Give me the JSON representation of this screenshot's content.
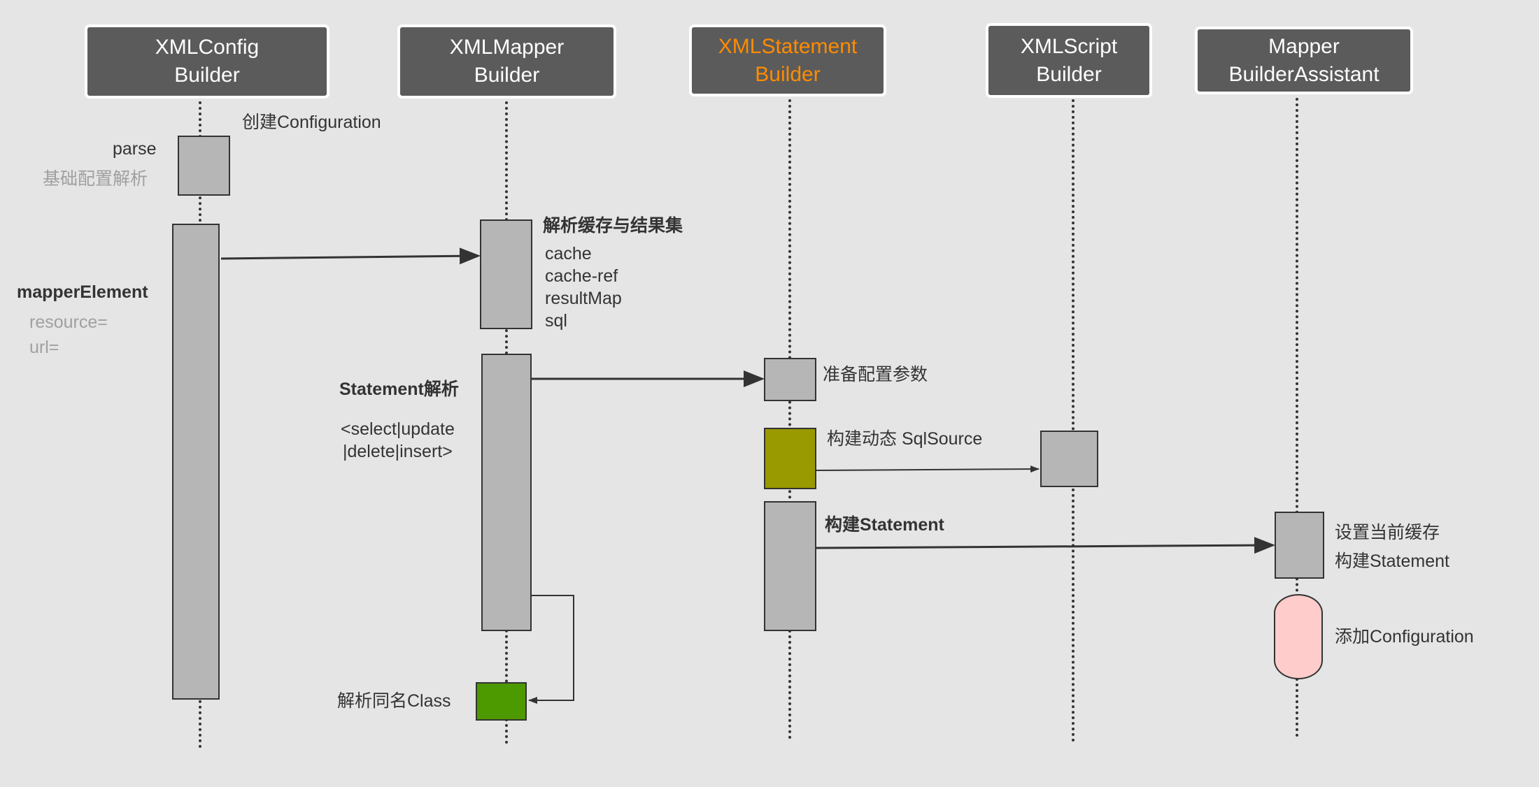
{
  "diagram": {
    "type": "sequence",
    "participants": [
      {
        "id": "xmlconfig",
        "line1": "XMLConfig",
        "line2": "Builder",
        "highlight": false
      },
      {
        "id": "xmlmapper",
        "line1": "XMLMapper",
        "line2": "Builder",
        "highlight": false
      },
      {
        "id": "xmlstatement",
        "line1": "XMLStatement",
        "line2": "Builder",
        "highlight": true,
        "color": "#ff8c00"
      },
      {
        "id": "xmlscript",
        "line1": "XMLScript",
        "line2": "Builder",
        "highlight": false
      },
      {
        "id": "assistant",
        "line1": "Mapper",
        "line2": "BuilderAssistant",
        "highlight": false
      }
    ],
    "labels": {
      "create_configuration": "创建Configuration",
      "parse": "parse",
      "base_config_parse": "基础配置解析",
      "mapper_element": "mapperElement",
      "resource": "resource=",
      "url": "url=",
      "parse_cache_result": "解析缓存与结果集",
      "mapper_items": [
        "cache",
        "cache-ref",
        "resultMap",
        "sql"
      ],
      "statement_parse": "Statement解析",
      "statement_tags_1": "<select|update",
      "statement_tags_2": "|delete|insert>",
      "parse_same_class": "解析同名Class",
      "prepare_params": "准备配置参数",
      "build_sqlsource": "构建动态 SqlSource",
      "build_statement": "构建Statement",
      "set_current_cache": "设置当前缓存",
      "build_statement_2": "构建Statement",
      "add_configuration": "添加Configuration"
    },
    "messages": [
      {
        "from": "xmlconfig",
        "to": "xmlmapper",
        "label": "mapperElement"
      },
      {
        "from": "xmlmapper",
        "to": "xmlstatement",
        "label": "Statement解析"
      },
      {
        "from": "xmlmapper",
        "to": "xmlmapper",
        "label": "解析同名Class",
        "self": true
      },
      {
        "from": "xmlstatement",
        "to": "xmlscript",
        "label": "构建动态 SqlSource"
      },
      {
        "from": "xmlstatement",
        "to": "assistant",
        "label": "构建Statement"
      }
    ],
    "colors": {
      "background": "#e5e5e5",
      "actor_fill": "#5b5b5b",
      "activation": "#b6b6b6",
      "olive": "#999900",
      "green": "#4d9900",
      "pink": "#ffcccc",
      "line": "#333333"
    }
  }
}
